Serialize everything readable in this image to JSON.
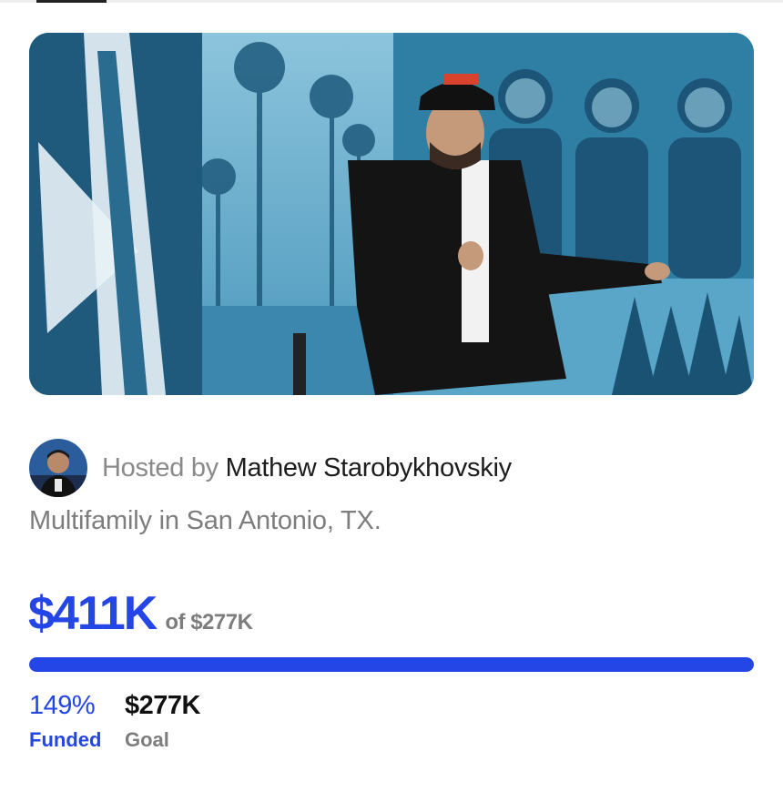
{
  "host": {
    "prefix": "Hosted by",
    "name": "Mathew Starobykhovskiy"
  },
  "subtitle": "Multifamily in San Antonio, TX.",
  "funding": {
    "raised": "$411K",
    "of_goal": "of $277K",
    "percent_label": "149%",
    "percent_caption": "Funded",
    "goal_value": "$277K",
    "goal_caption": "Goal",
    "progress_fraction": 1.0
  },
  "colors": {
    "accent": "#2446e6",
    "muted_text": "#7d7d7d",
    "hero_tint": "#2f7ea3"
  }
}
